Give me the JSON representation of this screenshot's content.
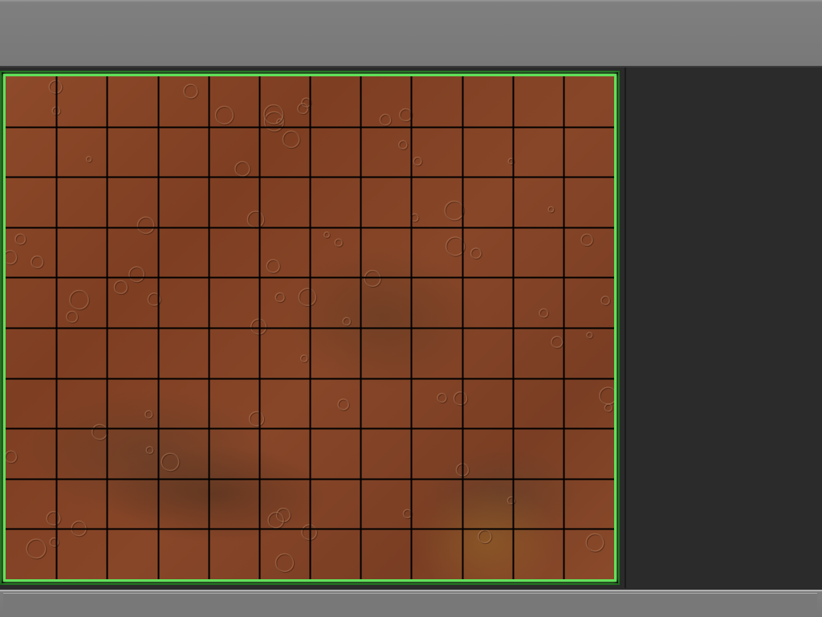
{
  "map": {
    "columns": 12,
    "rows": 10,
    "border_color": "#62e05a",
    "grid_color": "#000000",
    "terrain": "mars-surface"
  },
  "colors": {
    "toolbar": "#7a7a7a",
    "side_panel": "#2b2b2b",
    "terrain_base": "#864628"
  }
}
